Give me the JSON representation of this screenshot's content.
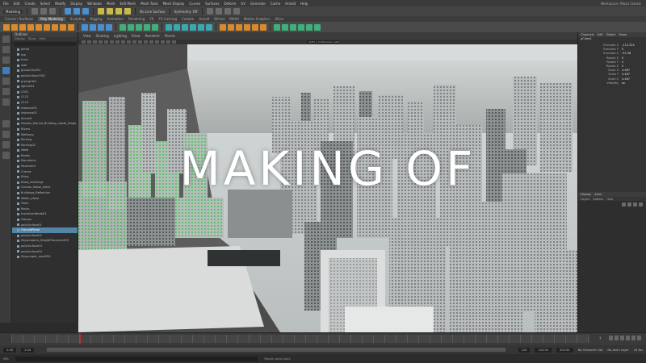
{
  "menubar": {
    "items": [
      "File",
      "Edit",
      "Create",
      "Select",
      "Modify",
      "Display",
      "Windows",
      "Mesh",
      "Edit Mesh",
      "Mesh Tools",
      "Mesh Display",
      "Curves",
      "Surfaces",
      "Deform",
      "UV",
      "Generate",
      "Cache",
      "Arnold",
      "Help"
    ],
    "workspace": "Workspace: Maya Classic"
  },
  "status_line": {
    "mode": "Modeling",
    "live_surface": "No Live Surface",
    "symmetry": "Symmetry: Off"
  },
  "shelf_tabs": [
    "Curves / Surfaces",
    "Poly Modeling",
    "Sculpting",
    "Rigging",
    "Animation",
    "Rendering",
    "FX",
    "FX Caching",
    "Custom",
    "Arnold",
    "Bifrost",
    "MASH",
    "Motion Graphics",
    "XGen"
  ],
  "shelf_active": "Poly Modeling",
  "outliner": {
    "title": "Outliner",
    "menus": [
      "Display",
      "Show",
      "Help"
    ],
    "items": [
      "persp",
      "top",
      "front",
      "side",
      "groupCity001",
      "polySurface1001",
      "grpLight01",
      "lights001",
      "C001",
      "C112",
      "C113",
      "instance01",
      "instance02",
      "Aircraft",
      "Houses_Marina_Building_rotate_Stage",
      "Rivers",
      "Walkway",
      "Parking",
      "Parking02",
      "Walls",
      "Roads",
      "Mountains",
      "Pavement",
      "Cranes",
      "Ships",
      "Road_markings",
      "Canvas_Noise_extra",
      "Buildings_Reflection",
      "Water_plane",
      "Trees",
      "Rocks",
      "transformNode01",
      "Groups",
      "polySurface01",
      "GroundPlane",
      "polySurface02",
      "Skyscrapers_HeightPlacement03",
      "polySurface03",
      "polySurface04",
      "Skyscraper_mod050"
    ],
    "selected_index": 34
  },
  "viewport": {
    "panel_menus": [
      "View",
      "Shading",
      "Lighting",
      "Show",
      "Renderer",
      "Panels"
    ],
    "camera_label": "ACES 1.0 SDR-video (sRGB)"
  },
  "channel_box": {
    "tabs": [
      "Channels",
      "Edit",
      "Object",
      "Show"
    ],
    "object_name": "pCube1",
    "attributes": [
      {
        "name": "Translate X",
        "value": "-112.324"
      },
      {
        "name": "Translate Y",
        "value": "0"
      },
      {
        "name": "Translate Z",
        "value": "-91.08"
      },
      {
        "name": "Rotate X",
        "value": "0"
      },
      {
        "name": "Rotate Y",
        "value": "0"
      },
      {
        "name": "Rotate Z",
        "value": "0"
      },
      {
        "name": "Scale X",
        "value": "4.467"
      },
      {
        "name": "Scale Y",
        "value": "4.467"
      },
      {
        "name": "Scale Z",
        "value": "4.467"
      },
      {
        "name": "Visibility",
        "value": "on"
      }
    ]
  },
  "layers": {
    "tabs": [
      "Display",
      "Anim"
    ],
    "menus": [
      "Layers",
      "Options",
      "Help"
    ]
  },
  "timeline": {
    "current_frame": "1"
  },
  "range": {
    "start": "1.00",
    "start_inner": "1.00",
    "end_inner": "120",
    "end": "120.00",
    "end_outer": "200.00",
    "character_set": "No Character Set",
    "anim_layer": "No Anim Layer",
    "fps": "24 fps"
  },
  "cmdline": {
    "lang": "MEL",
    "message": "Result: polyCube1"
  },
  "overlay": {
    "title": "MAKING OF"
  },
  "colors": {
    "accent": "#5285a6",
    "toolbar_orange": "#d98a2b",
    "toolbar_green": "#3fb07a"
  }
}
